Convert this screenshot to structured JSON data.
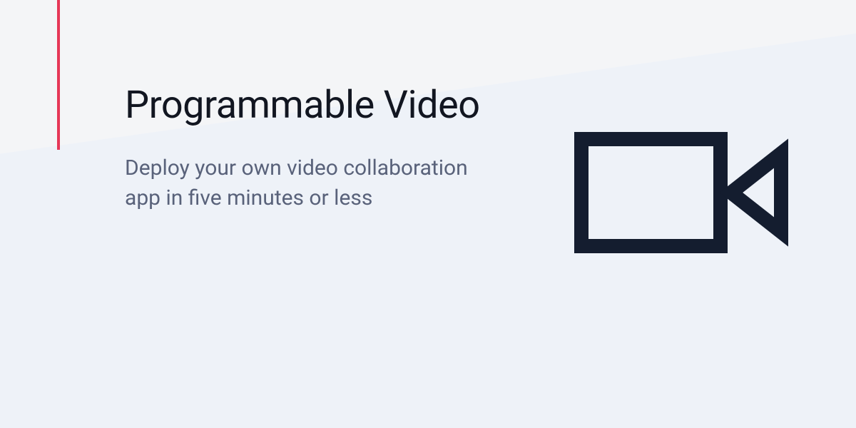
{
  "hero": {
    "title": "Programmable Video",
    "subtitle": "Deploy your own video collaboration app in five minutes or less"
  },
  "colors": {
    "accent": "#e63757",
    "icon": "#141d2f",
    "title": "#121621",
    "subtitle": "#59627a",
    "bg_top": "#f4f5f7",
    "bg_bottom": "#eef2f8"
  },
  "icon": {
    "name": "video-camera-icon"
  }
}
